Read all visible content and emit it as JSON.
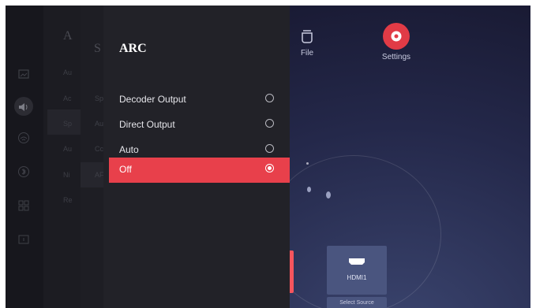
{
  "home": {
    "file_label": "File",
    "settings_label": "Settings",
    "source_card": {
      "label": "HDMI1",
      "caption": "Select Source"
    }
  },
  "menu_bg1": {
    "heading": "A",
    "items": [
      "Au",
      "Ac",
      "Sp",
      "Au",
      "Ni",
      "Re"
    ]
  },
  "menu_bg2": {
    "heading": "S",
    "items": [
      "Sp",
      "Au",
      "Cc",
      "AF"
    ]
  },
  "arc": {
    "title": "ARC",
    "options": [
      {
        "label": "Decoder Output",
        "selected": false
      },
      {
        "label": "Direct Output",
        "selected": false
      },
      {
        "label": "Auto",
        "selected": false
      },
      {
        "label": "Off",
        "selected": true
      }
    ]
  },
  "colors": {
    "accent": "#e8404b",
    "panel": "#222228"
  },
  "rail_icons": [
    "picture-icon",
    "sound-icon",
    "network-icon",
    "bluetooth-icon",
    "apps-icon",
    "info-icon"
  ]
}
